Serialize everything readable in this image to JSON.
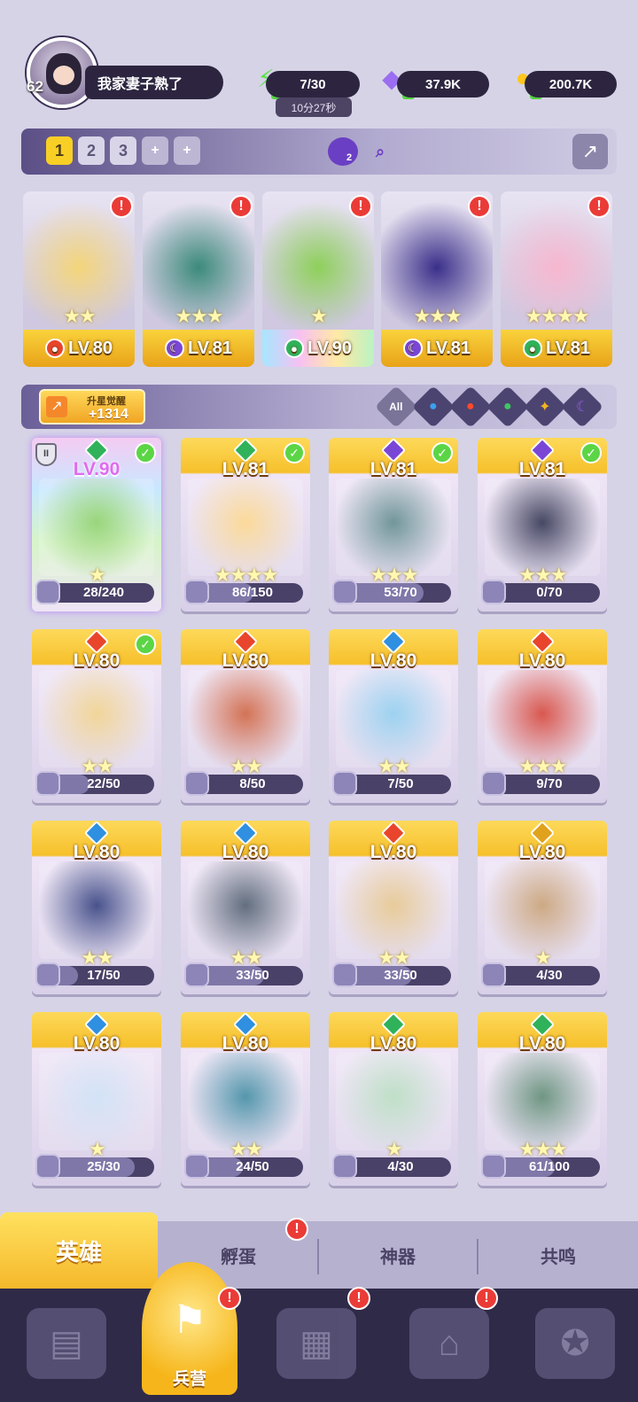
{
  "player": {
    "level": "62",
    "name": "我家妻子熟了"
  },
  "resources": {
    "energy": "7/30",
    "energy_timer": "10分27秒",
    "gems": "37.9K",
    "gold": "200.7K"
  },
  "team_tabs": [
    "1",
    "2",
    "3",
    "+",
    "+"
  ],
  "team_badge_count": "2",
  "team": [
    {
      "level": "LV.80",
      "element": "fire",
      "stars": "★★",
      "alert": true
    },
    {
      "level": "LV.81",
      "element": "dark",
      "stars": "★★★",
      "alert": true
    },
    {
      "level": "LV.90",
      "element": "wind",
      "stars": "★",
      "alert": true
    },
    {
      "level": "LV.81",
      "element": "dark",
      "stars": "★★★",
      "alert": true
    },
    {
      "level": "LV.81",
      "element": "wind",
      "stars": "★★★★",
      "alert": true
    }
  ],
  "awaken": {
    "label": "升星觉醒",
    "value": "+1314"
  },
  "filters": [
    "All",
    "water",
    "fire",
    "wind",
    "light",
    "dark"
  ],
  "filter_all_label": "All",
  "heroes": [
    {
      "level": "LV.90",
      "element": "wind",
      "fragments": "28/240",
      "fill": 0.12,
      "stars": "★",
      "checked": true,
      "rainbow": true
    },
    {
      "level": "LV.81",
      "element": "wind",
      "fragments": "86/150",
      "fill": 0.57,
      "stars": "★★★★",
      "checked": true
    },
    {
      "level": "LV.81",
      "element": "dark",
      "fragments": "53/70",
      "fill": 0.76,
      "stars": "★★★",
      "checked": true
    },
    {
      "level": "LV.81",
      "element": "dark",
      "fragments": "0/70",
      "fill": 0,
      "stars": "★★★",
      "checked": true
    },
    {
      "level": "LV.80",
      "element": "fire",
      "fragments": "22/50",
      "fill": 0.44,
      "stars": "★★",
      "checked": true
    },
    {
      "level": "LV.80",
      "element": "fire",
      "fragments": "8/50",
      "fill": 0.16,
      "stars": "★★",
      "checked": false
    },
    {
      "level": "LV.80",
      "element": "water",
      "fragments": "7/50",
      "fill": 0.14,
      "stars": "★★",
      "checked": false
    },
    {
      "level": "LV.80",
      "element": "fire",
      "fragments": "9/70",
      "fill": 0.13,
      "stars": "★★★",
      "checked": false
    },
    {
      "level": "LV.80",
      "element": "water",
      "fragments": "17/50",
      "fill": 0.34,
      "stars": "★★",
      "checked": false
    },
    {
      "level": "LV.80",
      "element": "water",
      "fragments": "33/50",
      "fill": 0.66,
      "stars": "★★",
      "checked": false
    },
    {
      "level": "LV.80",
      "element": "fire",
      "fragments": "33/50",
      "fill": 0.66,
      "stars": "★★",
      "checked": false
    },
    {
      "level": "LV.80",
      "element": "light",
      "fragments": "4/30",
      "fill": 0.13,
      "stars": "★",
      "checked": false
    },
    {
      "level": "LV.80",
      "element": "water",
      "fragments": "25/30",
      "fill": 0.83,
      "stars": "★",
      "checked": false
    },
    {
      "level": "LV.80",
      "element": "water",
      "fragments": "24/50",
      "fill": 0.48,
      "stars": "★★",
      "checked": false
    },
    {
      "level": "LV.80",
      "element": "wind",
      "fragments": "4/30",
      "fill": 0.13,
      "stars": "★",
      "checked": false
    },
    {
      "level": "LV.80",
      "element": "wind",
      "fragments": "61/100",
      "fill": 0.61,
      "stars": "★★★",
      "checked": false
    }
  ],
  "subtabs": [
    "英雄",
    "孵蛋",
    "神器",
    "共鸣"
  ],
  "nav": {
    "active_label": "兵营"
  },
  "colors": {
    "fire": "#e8452c",
    "water": "#2f8fe0",
    "wind": "#2fb25a",
    "light": "#e0a21c",
    "dark": "#7a46d6",
    "gold": "#f6c02b"
  }
}
